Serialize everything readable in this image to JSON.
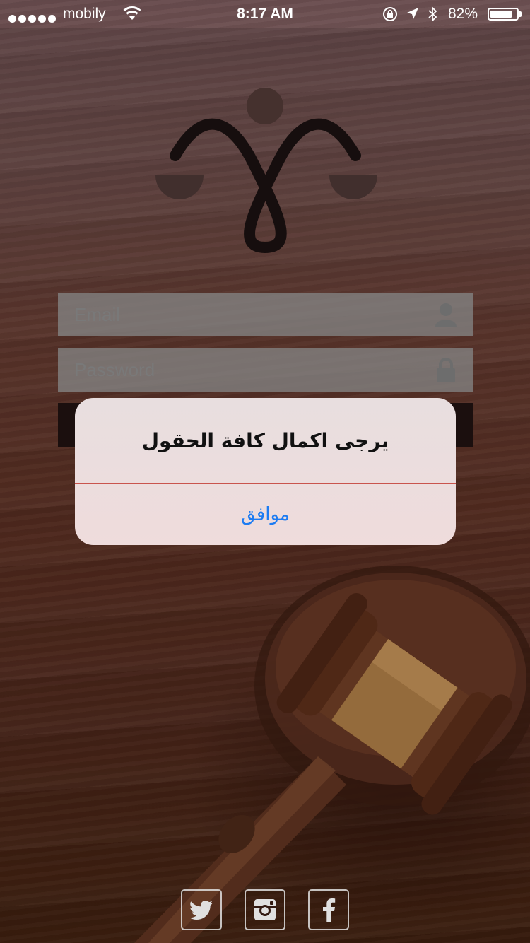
{
  "status_bar": {
    "carrier": "mobily",
    "time": "8:17 AM",
    "battery_percent_label": "82%",
    "battery_level": 0.82
  },
  "login_form": {
    "email_placeholder": "Email",
    "password_placeholder": "Password",
    "login_button_label": ""
  },
  "alert": {
    "message": "يرجى اكمال كافة الحقول",
    "ok_label": "موافق"
  },
  "social": {
    "items": [
      {
        "name": "twitter",
        "icon": "twitter-icon"
      },
      {
        "name": "instagram",
        "icon": "instagram-icon"
      },
      {
        "name": "facebook",
        "icon": "facebook-icon"
      }
    ]
  },
  "colors": {
    "alert_button_text": "#1e7cf2",
    "alert_divider": "#c9544d"
  }
}
